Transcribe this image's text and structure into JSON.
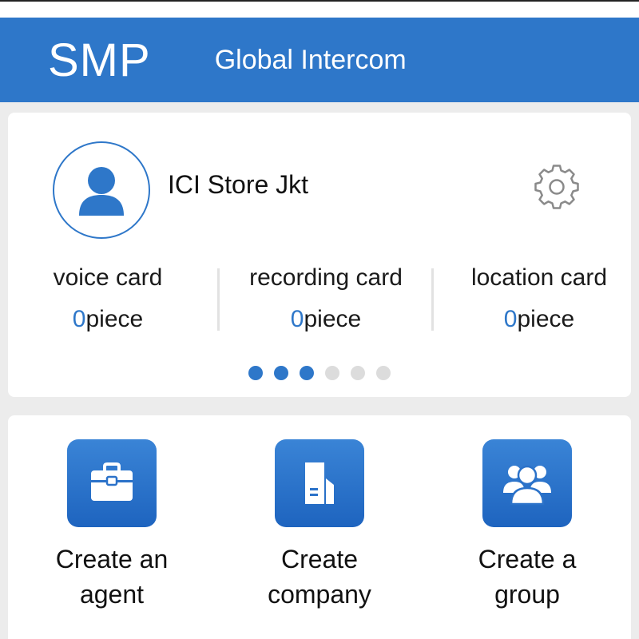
{
  "header": {
    "logo": "SMP",
    "title": "Global Intercom"
  },
  "profile": {
    "name": "ICI Store Jkt"
  },
  "stats": [
    {
      "label": "voice card",
      "value": "0",
      "unit": "piece"
    },
    {
      "label": "recording card",
      "value": "0",
      "unit": "piece"
    },
    {
      "label": "location card",
      "value": "0",
      "unit": "piece"
    }
  ],
  "pager": {
    "total": 6,
    "active": [
      0,
      1,
      2
    ]
  },
  "actions": [
    {
      "label_line1": "Create an",
      "label_line2": "agent",
      "icon": "briefcase-icon"
    },
    {
      "label_line1": "Create",
      "label_line2": "company",
      "icon": "building-icon"
    },
    {
      "label_line1": "Create a",
      "label_line2": "group",
      "icon": "group-icon"
    }
  ],
  "colors": {
    "primary": "#2e77c9",
    "background": "#ececec",
    "dot_inactive": "#dcdcdc"
  }
}
